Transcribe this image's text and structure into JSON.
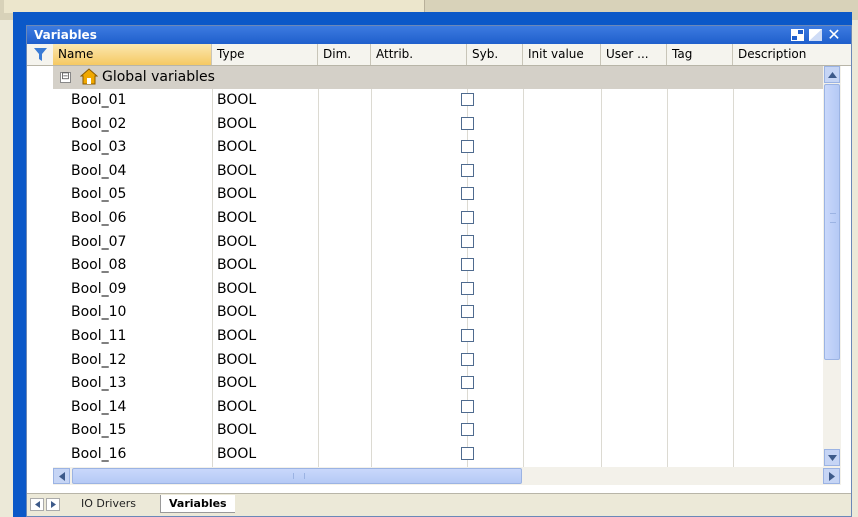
{
  "window": {
    "title": "Variables"
  },
  "columns": [
    {
      "key": "name",
      "label": "Name"
    },
    {
      "key": "type",
      "label": "Type"
    },
    {
      "key": "dim",
      "label": "Dim."
    },
    {
      "key": "attrib",
      "label": "Attrib."
    },
    {
      "key": "syb",
      "label": "Syb."
    },
    {
      "key": "init",
      "label": "Init value"
    },
    {
      "key": "user",
      "label": "User ..."
    },
    {
      "key": "tag",
      "label": "Tag"
    },
    {
      "key": "desc",
      "label": "Description"
    }
  ],
  "group": {
    "label": "Global variables",
    "expanded_symbol": "⊟"
  },
  "rows": [
    {
      "name": "Bool_01",
      "type": "BOOL",
      "syb_checked": false
    },
    {
      "name": "Bool_02",
      "type": "BOOL",
      "syb_checked": false
    },
    {
      "name": "Bool_03",
      "type": "BOOL",
      "syb_checked": false
    },
    {
      "name": "Bool_04",
      "type": "BOOL",
      "syb_checked": false
    },
    {
      "name": "Bool_05",
      "type": "BOOL",
      "syb_checked": false
    },
    {
      "name": "Bool_06",
      "type": "BOOL",
      "syb_checked": false
    },
    {
      "name": "Bool_07",
      "type": "BOOL",
      "syb_checked": false
    },
    {
      "name": "Bool_08",
      "type": "BOOL",
      "syb_checked": false
    },
    {
      "name": "Bool_09",
      "type": "BOOL",
      "syb_checked": false
    },
    {
      "name": "Bool_10",
      "type": "BOOL",
      "syb_checked": false
    },
    {
      "name": "Bool_11",
      "type": "BOOL",
      "syb_checked": false
    },
    {
      "name": "Bool_12",
      "type": "BOOL",
      "syb_checked": false
    },
    {
      "name": "Bool_13",
      "type": "BOOL",
      "syb_checked": false
    },
    {
      "name": "Bool_14",
      "type": "BOOL",
      "syb_checked": false
    },
    {
      "name": "Bool_15",
      "type": "BOOL",
      "syb_checked": false
    },
    {
      "name": "Bool_16",
      "type": "BOOL",
      "syb_checked": false
    }
  ],
  "tabs": [
    {
      "label": "IO Drivers",
      "active": false
    },
    {
      "label": "Variables",
      "active": true
    }
  ],
  "colors": {
    "title_bar": "#1f5fcc",
    "frame": "#0b58c8",
    "active_header": "#f5c963",
    "group_row": "#d4d0c8",
    "scrollbar": "#c6d5f5"
  },
  "icons": {
    "filter": "filter-icon",
    "home": "home-icon",
    "dock": "dock-icon",
    "maximize": "maximize-icon",
    "close": "close-icon"
  }
}
